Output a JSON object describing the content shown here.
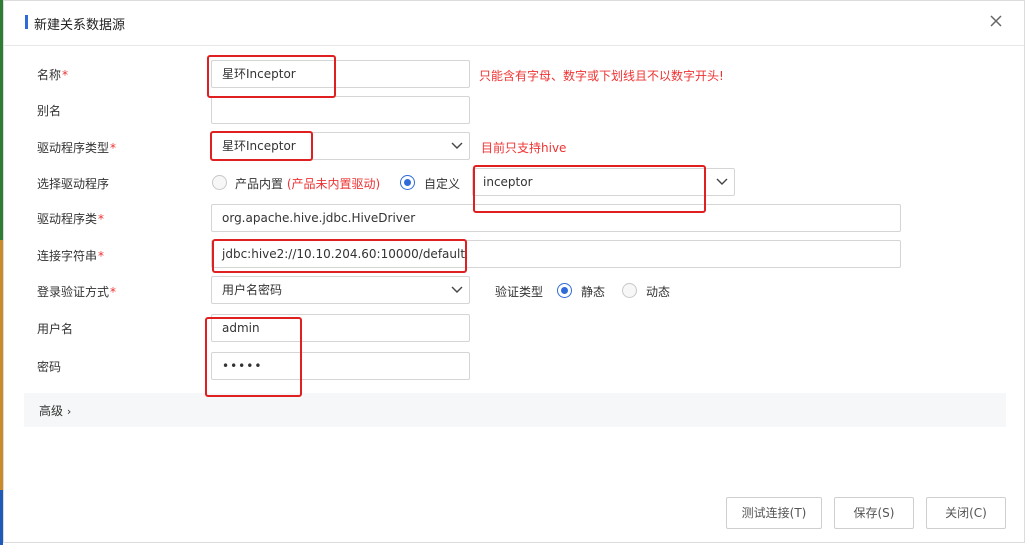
{
  "dialog": {
    "title": "新建关系数据源"
  },
  "form": {
    "name": {
      "label": "名称",
      "value": "星环Inceptor",
      "hint": "只能含有字母、数字或下划线且不以数字开头!"
    },
    "alias": {
      "label": "别名",
      "value": ""
    },
    "driver_type": {
      "label": "驱动程序类型",
      "value": "星环Inceptor",
      "hint": "目前只支持hive"
    },
    "driver_select": {
      "label": "选择驱动程序",
      "option_builtin": "产品内置",
      "builtin_note": "(产品未内置驱动)",
      "option_custom": "自定义",
      "selected": "custom",
      "custom_value": "inceptor"
    },
    "driver_class": {
      "label": "驱动程序类",
      "value": "org.apache.hive.jdbc.HiveDriver"
    },
    "conn_string": {
      "label": "连接字符串",
      "value": "jdbc:hive2://10.10.204.60:10000/default"
    },
    "auth_method": {
      "label": "登录验证方式",
      "value": "用户名密码",
      "verify_type_label": "验证类型",
      "option_static": "静态",
      "option_dynamic": "动态",
      "selected": "static"
    },
    "username": {
      "label": "用户名",
      "value": "admin"
    },
    "password": {
      "label": "密码",
      "value": "•••••"
    },
    "advanced": {
      "label": "高级"
    }
  },
  "buttons": {
    "test": "测试连接(T)",
    "save": "保存(S)",
    "close": "关闭(C)"
  },
  "colors": {
    "accent": "#2f6bd8",
    "required": "#e33333",
    "annotation": "#e02020"
  }
}
